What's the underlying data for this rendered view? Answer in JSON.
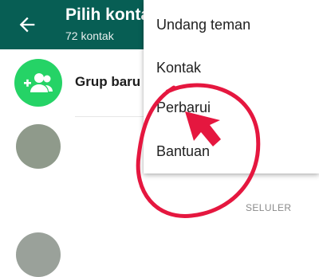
{
  "appbar": {
    "title": "Pilih kontak",
    "subtitle": "72 kontak",
    "back_icon": "arrow-left-icon"
  },
  "list": {
    "new_group_label": "Grup baru",
    "new_group_icon": "group-add-icon",
    "section_label": "SELULER"
  },
  "menu": {
    "items": [
      {
        "label": "Undang teman"
      },
      {
        "label": "Kontak"
      },
      {
        "label": "Perbarui"
      },
      {
        "label": "Bantuan"
      }
    ]
  },
  "colors": {
    "appbar": "#075e54",
    "group_avatar": "#25d366",
    "annotation": "#e5173f"
  }
}
